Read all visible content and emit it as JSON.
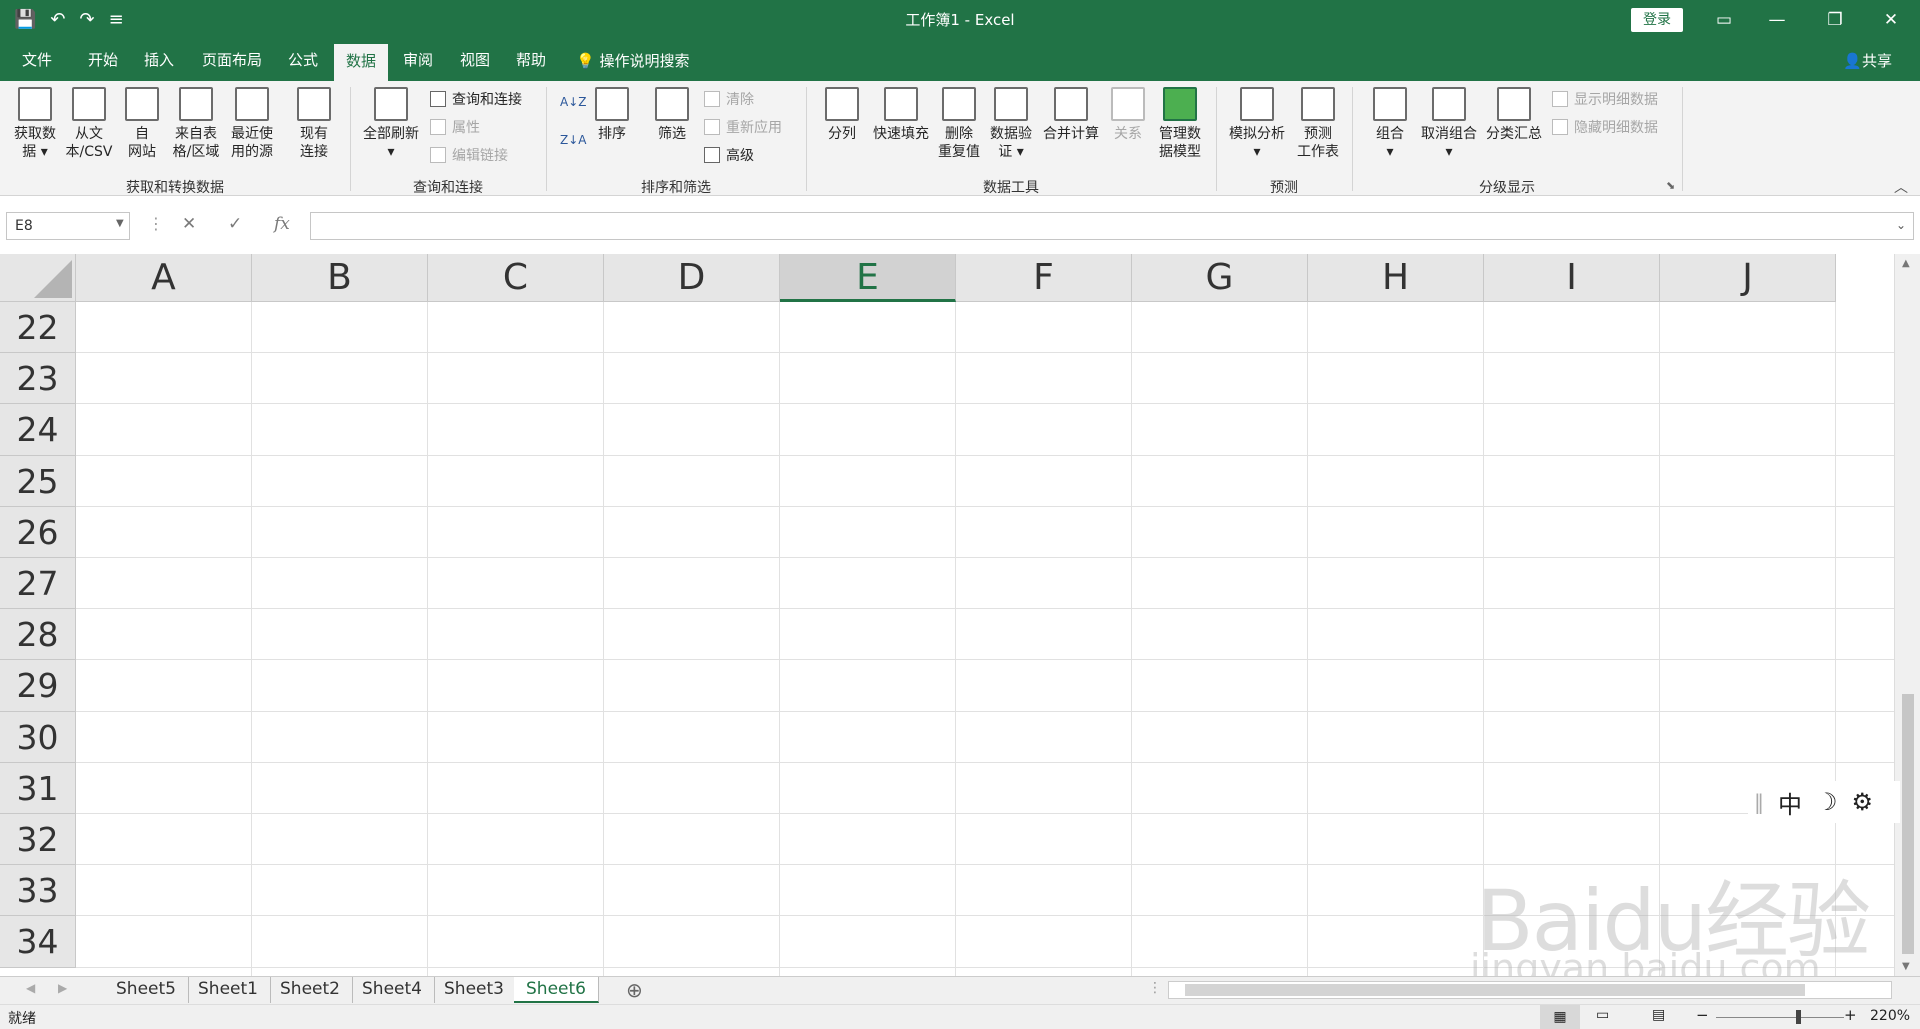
{
  "window": {
    "title": "工作簿1  -  Excel",
    "login_label": "登录",
    "minimize": "—",
    "restore": "❐",
    "close": "✕"
  },
  "qat": {
    "save": "💾",
    "undo": "↶",
    "redo": "↷",
    "customize": "≡"
  },
  "tabs": [
    "文件",
    "开始",
    "插入",
    "页面布局",
    "公式",
    "数据",
    "审阅",
    "视图",
    "帮助"
  ],
  "active_tab": "数据",
  "tell_me": "操作说明搜索",
  "share": "共享",
  "ribbon": {
    "get_data": "获取数\n据 ▾",
    "from_text": "从文\n本/CSV",
    "from_web": "自\n网站",
    "from_table": "来自表\n格/区域",
    "recent_sources": "最近使\n用的源",
    "existing_conn": "现有\n连接",
    "refresh_all": "全部刷新\n▾",
    "queries_conn": "查询和连接",
    "properties": "属性",
    "edit_links": "编辑链接",
    "sort_az": "A↓Z",
    "sort_za": "Z↓A",
    "sort": "排序",
    "filter": "筛选",
    "clear": "清除",
    "reapply": "重新应用",
    "advanced": "高级",
    "text_to_col": "分列",
    "flash_fill": "快速填充",
    "remove_dup": "删除\n重复值",
    "data_valid": "数据验\n证 ▾",
    "consolidate": "合并计算",
    "relations": "关系",
    "data_model": "管理数\n据模型",
    "whatif": "模拟分析\n▾",
    "forecast": "预测\n工作表",
    "group": "组合\n▾",
    "ungroup": "取消组合\n▾",
    "subtotal": "分类汇总",
    "show_detail": "显示明细数据",
    "hide_detail": "隐藏明细数据",
    "groups": [
      "获取和转换数据",
      "查询和连接",
      "排序和筛选",
      "数据工具",
      "预测",
      "分级显示"
    ]
  },
  "formula_bar": {
    "name_box": "E8",
    "cancel": "✕",
    "enter": "✓",
    "fx": "fx",
    "value": ""
  },
  "columns": [
    "A",
    "B",
    "C",
    "D",
    "E",
    "F",
    "G",
    "H",
    "I",
    "J"
  ],
  "selected_column": "E",
  "rows": [
    "22",
    "23",
    "24",
    "25",
    "26",
    "27",
    "28",
    "29",
    "30",
    "31",
    "32",
    "33",
    "34"
  ],
  "sheets": [
    "Sheet5",
    "Sheet1",
    "Sheet2",
    "Sheet4",
    "Sheet3",
    "Sheet6"
  ],
  "active_sheet": "Sheet6",
  "status": {
    "ready": "就绪",
    "zoom": "220%"
  },
  "ime": {
    "lang": "中",
    "moon": "☽",
    "gear": "⚙"
  },
  "watermark": {
    "main": "Baidu经验",
    "sub": "jingyan.baidu.com"
  }
}
